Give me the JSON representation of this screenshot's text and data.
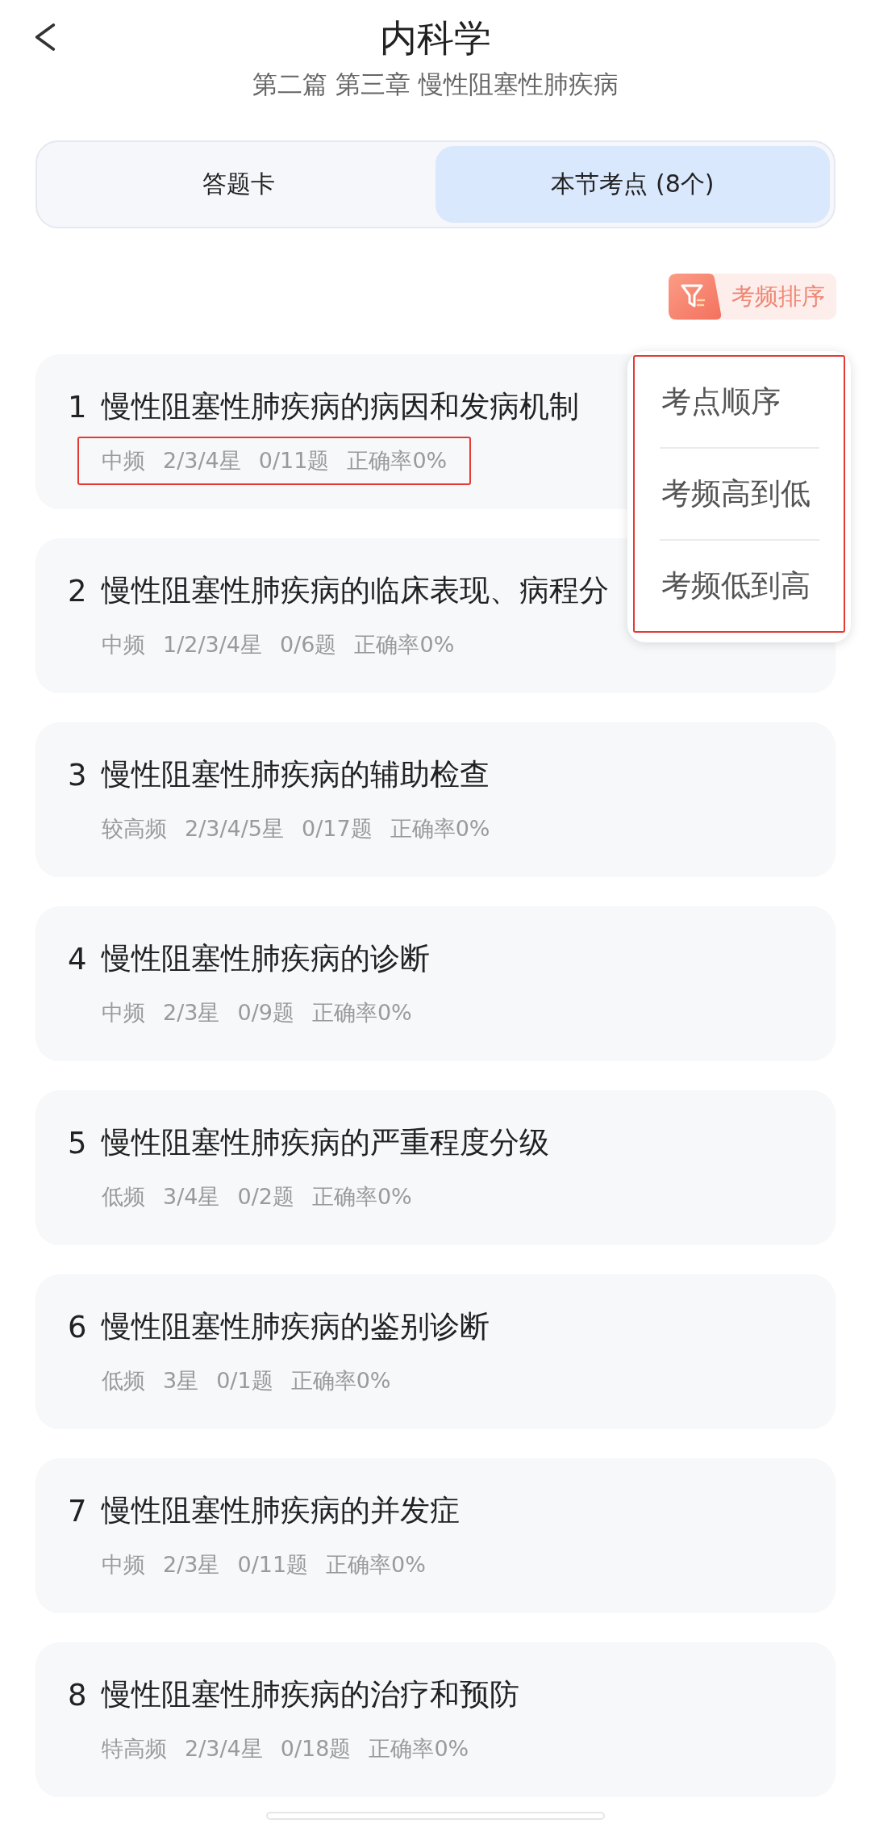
{
  "header": {
    "title": "内科学",
    "subtitle": "第二篇 第三章 慢性阻塞性肺疾病"
  },
  "tabs": [
    {
      "label": "答题卡",
      "selected": false
    },
    {
      "label": "本节考点 (8个)",
      "selected": true
    }
  ],
  "sort_button": {
    "label": "考频排序"
  },
  "sort_menu": {
    "highlighted": true,
    "items": [
      {
        "label": "考点顺序"
      },
      {
        "label": "考频高到低"
      },
      {
        "label": "考频低到高"
      }
    ]
  },
  "topics": [
    {
      "number": "1",
      "title": "慢性阻塞性肺疾病的病因和发病机制",
      "frequency": "中频",
      "star_grades": "2/3/4星",
      "answered": "0/11题",
      "accuracy": "正确率0%",
      "highlighted": true
    },
    {
      "number": "2",
      "title": "慢性阻塞性肺疾病的临床表现、病程分",
      "frequency": "中频",
      "star_grades": "1/2/3/4星",
      "answered": "0/6题",
      "accuracy": "正确率0%",
      "highlighted": false
    },
    {
      "number": "3",
      "title": "慢性阻塞性肺疾病的辅助检查",
      "frequency": "较高频",
      "star_grades": "2/3/4/5星",
      "answered": "0/17题",
      "accuracy": "正确率0%",
      "highlighted": false
    },
    {
      "number": "4",
      "title": "慢性阻塞性肺疾病的诊断",
      "frequency": "中频",
      "star_grades": "2/3星",
      "answered": "0/9题",
      "accuracy": "正确率0%",
      "highlighted": false
    },
    {
      "number": "5",
      "title": "慢性阻塞性肺疾病的严重程度分级",
      "frequency": "低频",
      "star_grades": "3/4星",
      "answered": "0/2题",
      "accuracy": "正确率0%",
      "highlighted": false
    },
    {
      "number": "6",
      "title": "慢性阻塞性肺疾病的鉴别诊断",
      "frequency": "低频",
      "star_grades": "3星",
      "answered": "0/1题",
      "accuracy": "正确率0%",
      "highlighted": false
    },
    {
      "number": "7",
      "title": "慢性阻塞性肺疾病的并发症",
      "frequency": "中频",
      "star_grades": "2/3星",
      "answered": "0/11题",
      "accuracy": "正确率0%",
      "highlighted": false
    },
    {
      "number": "8",
      "title": "慢性阻塞性肺疾病的治疗和预防",
      "frequency": "特高频",
      "star_grades": "2/3/4星",
      "answered": "0/18题",
      "accuracy": "正确率0%",
      "highlighted": false
    }
  ]
}
